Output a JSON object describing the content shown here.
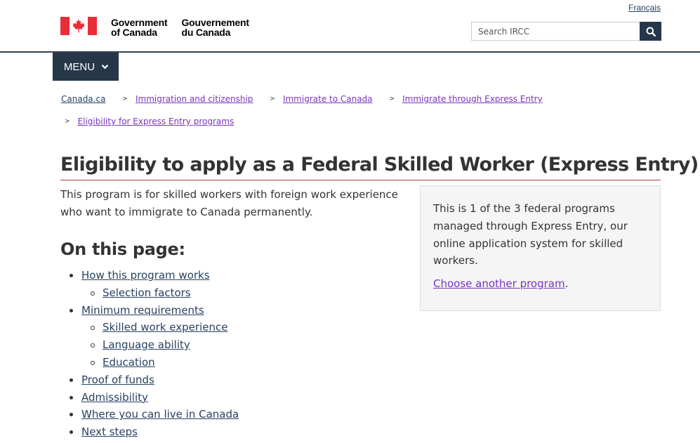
{
  "header": {
    "language_link": "Français",
    "signature_en": [
      "Government",
      "of Canada"
    ],
    "signature_fr": [
      "Gouvernement",
      "du Canada"
    ],
    "search_placeholder": "Search IRCC"
  },
  "menu": {
    "label": "MENU"
  },
  "breadcrumb": [
    "Canada.ca",
    "Immigration and citizenship",
    "Immigrate to Canada",
    "Immigrate through Express Entry",
    "Eligibility for Express Entry programs"
  ],
  "main": {
    "title": "Eligibility to apply as a Federal Skilled Worker (Express Entry)",
    "intro": "This program is for skilled workers with foreign work experience who want to immigrate to Canada permanently.",
    "on_this_page_heading": "On this page:",
    "toc": [
      {
        "label": "How this program works",
        "children": [
          "Selection factors"
        ]
      },
      {
        "label": "Minimum requirements",
        "children": [
          "Skilled work experience",
          "Language ability",
          "Education"
        ]
      },
      {
        "label": "Proof of funds",
        "children": []
      },
      {
        "label": "Admissibility",
        "children": []
      },
      {
        "label": "Where you can live in Canada",
        "children": []
      },
      {
        "label": "Next steps",
        "children": []
      }
    ]
  },
  "aside": {
    "text": "This is 1 of the 3 federal programs managed through Express Entry, our online application system for skilled workers.",
    "link": "Choose another program",
    "link_suffix": "."
  },
  "colors": {
    "header_navy": "#26374a",
    "link_blue": "#284162",
    "visited_purple": "#7834bc",
    "title_rule_red": "#af3c43",
    "flag_red": "#eb2d37",
    "aside_bg": "#f5f5f5"
  }
}
